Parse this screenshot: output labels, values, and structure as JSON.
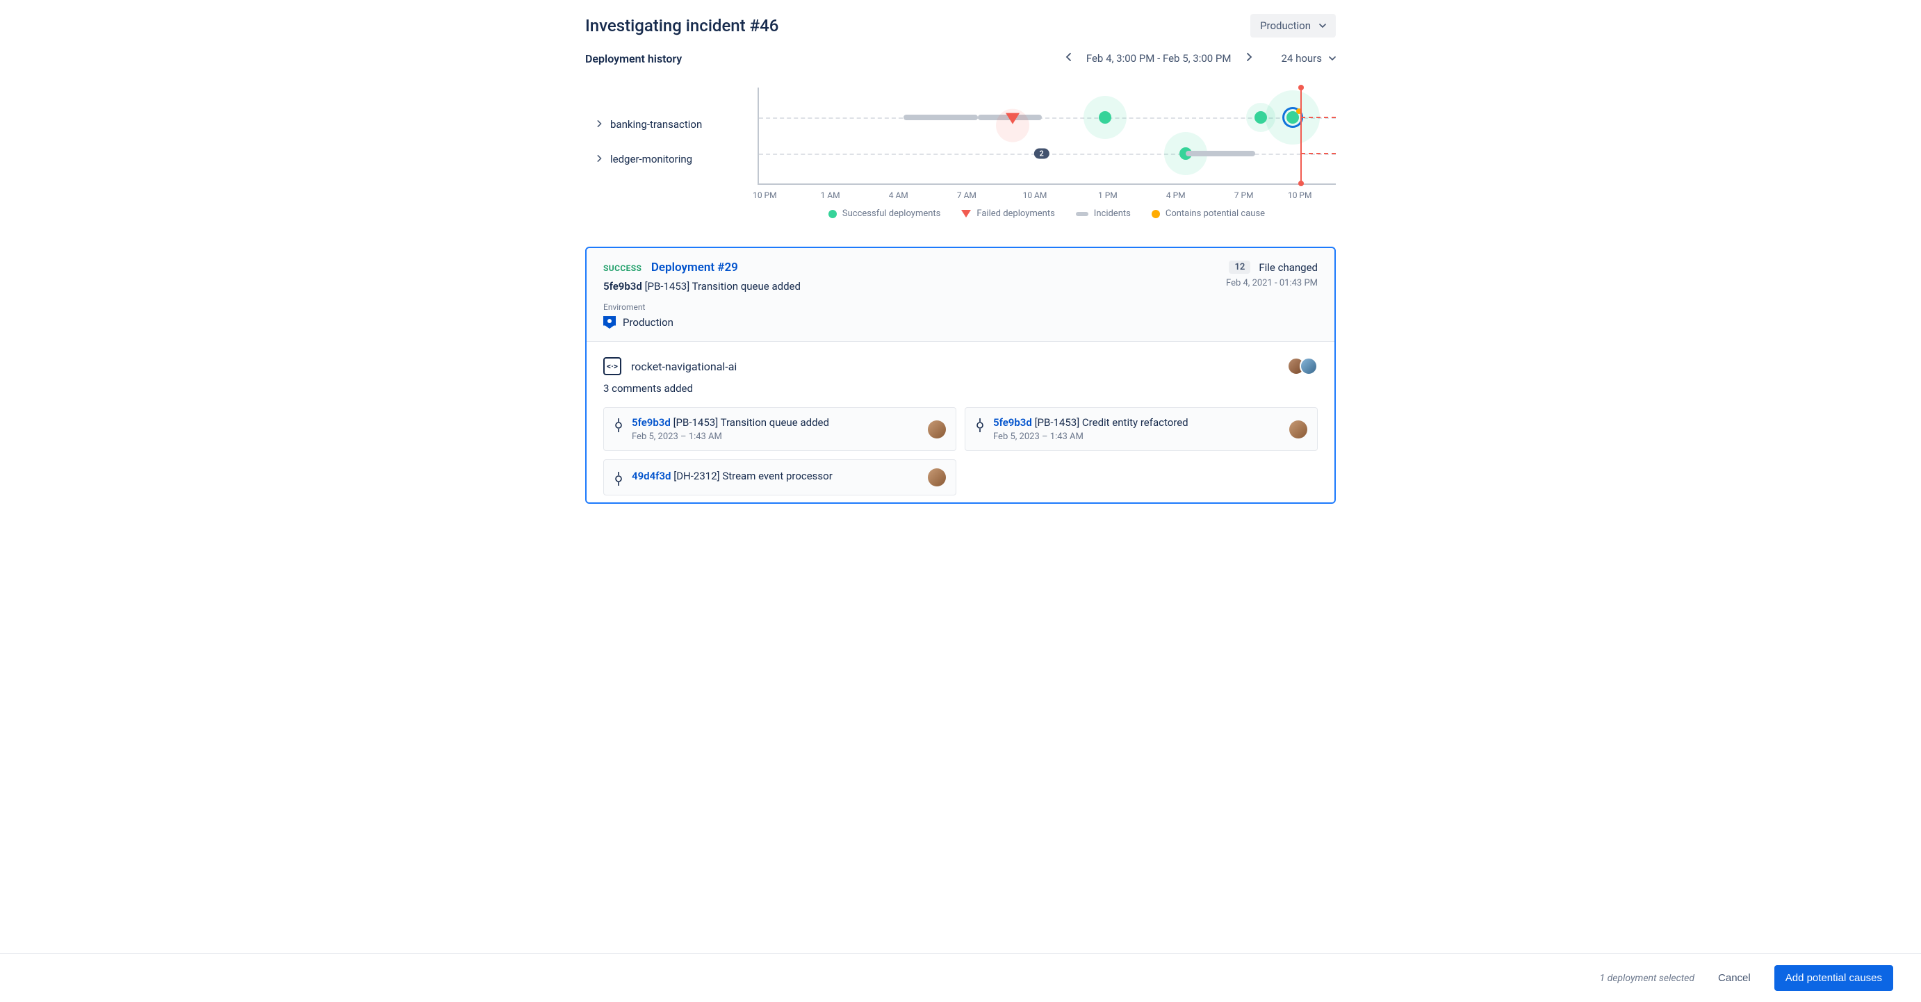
{
  "header": {
    "title": "Investigating incident #46",
    "env_selector": "Production",
    "subtitle": "Deployment history",
    "date_range": "Feb 4, 3:00 PM - Feb 5, 3:00 PM",
    "time_range": "24 hours"
  },
  "timeline": {
    "rows": [
      {
        "label": "banking-transaction"
      },
      {
        "label": "ledger-monitoring"
      }
    ],
    "axis": [
      "10 PM",
      "1 AM",
      "4 AM",
      "7 AM",
      "10 AM",
      "1 PM",
      "4 PM",
      "7 PM",
      "10 PM"
    ],
    "cluster_count": "2",
    "legend": {
      "success": "Successful deployments",
      "failed": "Failed deployments",
      "incidents": "Incidents",
      "potential": "Contains potential cause"
    }
  },
  "deployment": {
    "status": "SUCCESS",
    "title": "Deployment #29",
    "commit_sha": "5fe9b3d",
    "commit_msg": "[PB-1453] Transition queue added",
    "env_label": "Enviroment",
    "env_value": "Production",
    "files_changed_count": "12",
    "files_changed_label": "File changed",
    "timestamp": "Feb 4, 2021 - 01:43 PM",
    "repo_name": "rocket-navigational-ai",
    "comments_text": "3 comments added",
    "commits": [
      {
        "sha": "5fe9b3d",
        "msg": "[PB-1453] Transition queue added",
        "time": "Feb 5, 2023 – 1:43 AM"
      },
      {
        "sha": "5fe9b3d",
        "msg": "[PB-1453] Credit entity refactored",
        "time": "Feb 5, 2023 – 1:43 AM"
      },
      {
        "sha": "49d4f3d",
        "msg": "[DH-2312] Stream event processor",
        "time": ""
      }
    ]
  },
  "footer": {
    "selected": "1 deployment selected",
    "cancel": "Cancel",
    "primary": "Add potential causes"
  },
  "chart_data": {
    "type": "timeline",
    "x_axis": {
      "ticks": [
        "10 PM",
        "1 AM",
        "4 AM",
        "7 AM",
        "10 AM",
        "1 PM",
        "4 PM",
        "7 PM",
        "10 PM"
      ],
      "range_hours": 24
    },
    "current_time_marker_pct": 94,
    "tracks": [
      {
        "name": "banking-transaction",
        "events": [
          {
            "kind": "incident",
            "start_pct": 25,
            "end_pct": 38
          },
          {
            "kind": "incident",
            "start_pct": 38,
            "end_pct": 49
          },
          {
            "kind": "failed",
            "x_pct": 44,
            "halo": "sm"
          },
          {
            "kind": "success",
            "x_pct": 60,
            "halo": "md"
          },
          {
            "kind": "success",
            "x_pct": 87,
            "halo": "sm"
          },
          {
            "kind": "success",
            "x_pct": 92.5,
            "halo": "lg",
            "selected": true,
            "potential": true
          }
        ]
      },
      {
        "name": "ledger-monitoring",
        "events": [
          {
            "kind": "cluster",
            "x_pct": 49,
            "count": 2
          },
          {
            "kind": "success",
            "x_pct": 74,
            "halo": "md"
          },
          {
            "kind": "incident",
            "start_pct": 74,
            "end_pct": 86
          }
        ]
      }
    ]
  }
}
